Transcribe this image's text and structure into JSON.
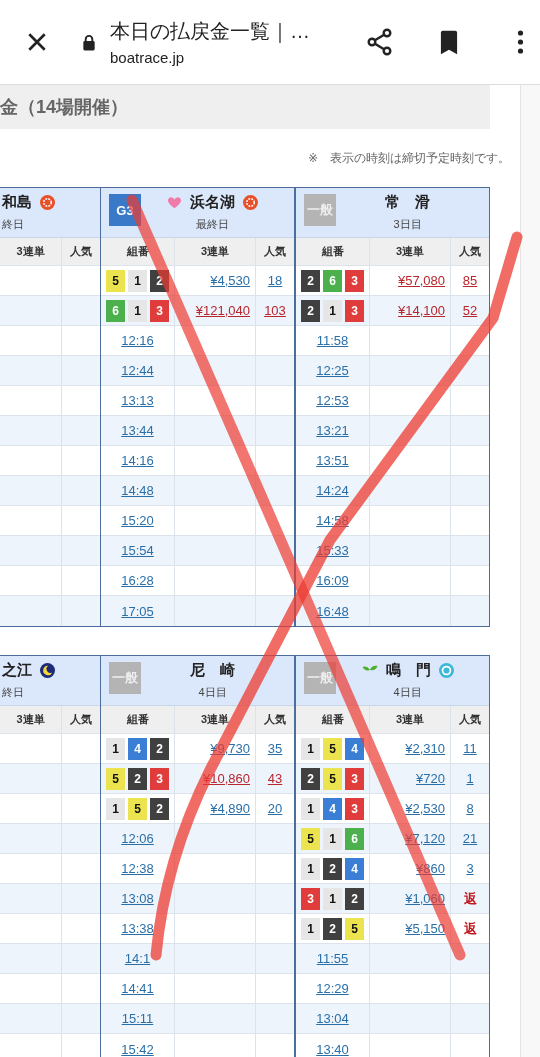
{
  "browser": {
    "title": "本日の払戻金一覧｜…",
    "url": "boatrace.jp"
  },
  "page_heading": "金（14場開催）",
  "note": "※　表示の時刻は締切予定時刻です。",
  "sections": [
    {
      "venues": [
        {
          "partial": true,
          "name": "和島",
          "icon_after": {
            "kind": "sun"
          },
          "day": "終日",
          "columns": [
            "3連単",
            "人気"
          ]
        },
        {
          "partial": false,
          "badge": {
            "kind": "g3",
            "text": "G3"
          },
          "icon_before": {
            "kind": "heart"
          },
          "name": "浜名湖",
          "icon_after": {
            "kind": "sun"
          },
          "day": "最終日",
          "columns": [
            "組番",
            "3連単",
            "人気"
          ],
          "rows": [
            {
              "kind": "result",
              "boats": [
                {
                  "number": "5",
                  "color": "#ece44e"
                },
                {
                  "number": "1",
                  "color": "#e6e6e6"
                },
                {
                  "number": "2",
                  "color": "#404040"
                }
              ],
              "payout": "¥4,530",
              "popularity": "18",
              "high": false,
              "refund": false
            },
            {
              "kind": "result",
              "boats": [
                {
                  "number": "6",
                  "color": "#4cb04c"
                },
                {
                  "number": "1",
                  "color": "#e6e6e6"
                },
                {
                  "number": "3",
                  "color": "#e03c3c"
                }
              ],
              "payout": "¥121,040",
              "popularity": "103",
              "high": true,
              "refund": false
            },
            {
              "kind": "time",
              "time": "12:16"
            },
            {
              "kind": "time",
              "time": "12:44"
            },
            {
              "kind": "time",
              "time": "13:13"
            },
            {
              "kind": "time",
              "time": "13:44"
            },
            {
              "kind": "time",
              "time": "14:16"
            },
            {
              "kind": "time",
              "time": "14:48"
            },
            {
              "kind": "time",
              "time": "15:20"
            },
            {
              "kind": "time",
              "time": "15:54"
            },
            {
              "kind": "time",
              "time": "16:28"
            },
            {
              "kind": "time",
              "time": "17:05"
            }
          ]
        },
        {
          "partial": false,
          "badge": {
            "kind": "general",
            "text": "一般"
          },
          "name": "常　滑",
          "day": "3日目",
          "columns": [
            "組番",
            "3連単",
            "人気"
          ],
          "rows": [
            {
              "kind": "result",
              "boats": [
                {
                  "number": "2",
                  "color": "#404040"
                },
                {
                  "number": "6",
                  "color": "#4cb04c"
                },
                {
                  "number": "3",
                  "color": "#e03c3c"
                }
              ],
              "payout": "¥57,080",
              "popularity": "85",
              "high": true,
              "refund": false
            },
            {
              "kind": "result",
              "boats": [
                {
                  "number": "2",
                  "color": "#404040"
                },
                {
                  "number": "1",
                  "color": "#e6e6e6"
                },
                {
                  "number": "3",
                  "color": "#e03c3c"
                }
              ],
              "payout": "¥14,100",
              "popularity": "52",
              "high": true,
              "refund": false
            },
            {
              "kind": "time",
              "time": "11:58"
            },
            {
              "kind": "time",
              "time": "12:25"
            },
            {
              "kind": "time",
              "time": "12:53"
            },
            {
              "kind": "time",
              "time": "13:21"
            },
            {
              "kind": "time",
              "time": "13:51"
            },
            {
              "kind": "time",
              "time": "14:24"
            },
            {
              "kind": "time",
              "time": "14:58"
            },
            {
              "kind": "time",
              "time": "15:33"
            },
            {
              "kind": "time",
              "time": "16:09"
            },
            {
              "kind": "time",
              "time": "16:48"
            }
          ]
        }
      ]
    },
    {
      "venues": [
        {
          "partial": true,
          "name": "之江",
          "icon_after": {
            "kind": "moon"
          },
          "day": "終日",
          "columns": [
            "3連単",
            "人気"
          ]
        },
        {
          "partial": false,
          "badge": {
            "kind": "general",
            "text": "一般"
          },
          "name": "尼　崎",
          "day": "4日目",
          "columns": [
            "組番",
            "3連単",
            "人気"
          ],
          "rows": [
            {
              "kind": "result",
              "boats": [
                {
                  "number": "1",
                  "color": "#e6e6e6"
                },
                {
                  "number": "4",
                  "color": "#3a7fd5"
                },
                {
                  "number": "2",
                  "color": "#404040"
                }
              ],
              "payout": "¥9,730",
              "popularity": "35",
              "high": false,
              "refund": false
            },
            {
              "kind": "result",
              "boats": [
                {
                  "number": "5",
                  "color": "#ece44e"
                },
                {
                  "number": "2",
                  "color": "#404040"
                },
                {
                  "number": "3",
                  "color": "#e03c3c"
                }
              ],
              "payout": "¥10,860",
              "popularity": "43",
              "high": true,
              "refund": false
            },
            {
              "kind": "result",
              "boats": [
                {
                  "number": "1",
                  "color": "#e6e6e6"
                },
                {
                  "number": "5",
                  "color": "#ece44e"
                },
                {
                  "number": "2",
                  "color": "#404040"
                }
              ],
              "payout": "¥4,890",
              "popularity": "20",
              "high": false,
              "refund": false
            },
            {
              "kind": "time",
              "time": "12:06"
            },
            {
              "kind": "time",
              "time": "12:38"
            },
            {
              "kind": "time",
              "time": "13:08"
            },
            {
              "kind": "time",
              "time": "13:38"
            },
            {
              "kind": "time",
              "time": "14:1"
            },
            {
              "kind": "time",
              "time": "14:41"
            },
            {
              "kind": "time",
              "time": "15:11"
            },
            {
              "kind": "time",
              "time": "15:42"
            }
          ]
        },
        {
          "partial": false,
          "badge": {
            "kind": "general",
            "text": "一般"
          },
          "icon_before": {
            "kind": "leaf"
          },
          "name": "鳴　門",
          "icon_after": {
            "kind": "ring"
          },
          "day": "4日目",
          "columns": [
            "組番",
            "3連単",
            "人気"
          ],
          "rows": [
            {
              "kind": "result",
              "boats": [
                {
                  "number": "1",
                  "color": "#e6e6e6"
                },
                {
                  "number": "5",
                  "color": "#ece44e"
                },
                {
                  "number": "4",
                  "color": "#3a7fd5"
                }
              ],
              "payout": "¥2,310",
              "popularity": "11",
              "high": false,
              "refund": false
            },
            {
              "kind": "result",
              "boats": [
                {
                  "number": "2",
                  "color": "#404040"
                },
                {
                  "number": "5",
                  "color": "#ece44e"
                },
                {
                  "number": "3",
                  "color": "#e03c3c"
                }
              ],
              "payout": "¥720",
              "popularity": "1",
              "high": false,
              "refund": false
            },
            {
              "kind": "result",
              "boats": [
                {
                  "number": "1",
                  "color": "#e6e6e6"
                },
                {
                  "number": "4",
                  "color": "#3a7fd5"
                },
                {
                  "number": "3",
                  "color": "#e03c3c"
                }
              ],
              "payout": "¥2,530",
              "popularity": "8",
              "high": false,
              "refund": false
            },
            {
              "kind": "result",
              "boats": [
                {
                  "number": "5",
                  "color": "#ece44e"
                },
                {
                  "number": "1",
                  "color": "#e6e6e6"
                },
                {
                  "number": "6",
                  "color": "#4cb04c"
                }
              ],
              "payout": "¥7,120",
              "popularity": "21",
              "high": false,
              "refund": false
            },
            {
              "kind": "result",
              "boats": [
                {
                  "number": "1",
                  "color": "#e6e6e6"
                },
                {
                  "number": "2",
                  "color": "#404040"
                },
                {
                  "number": "4",
                  "color": "#3a7fd5"
                }
              ],
              "payout": "¥860",
              "popularity": "3",
              "high": false,
              "refund": false
            },
            {
              "kind": "result",
              "boats": [
                {
                  "number": "3",
                  "color": "#e03c3c"
                },
                {
                  "number": "1",
                  "color": "#e6e6e6"
                },
                {
                  "number": "2",
                  "color": "#404040"
                }
              ],
              "payout": "¥1,060",
              "popularity": "返",
              "high": false,
              "refund": true
            },
            {
              "kind": "result",
              "boats": [
                {
                  "number": "1",
                  "color": "#e6e6e6"
                },
                {
                  "number": "2",
                  "color": "#404040"
                },
                {
                  "number": "5",
                  "color": "#ece44e"
                }
              ],
              "payout": "¥5,150",
              "popularity": "返",
              "high": false,
              "refund": true
            },
            {
              "kind": "time",
              "time": "11:55"
            },
            {
              "kind": "time",
              "time": "12:29"
            },
            {
              "kind": "time",
              "time": "13:04"
            },
            {
              "kind": "time",
              "time": "13:40"
            }
          ]
        }
      ]
    }
  ]
}
